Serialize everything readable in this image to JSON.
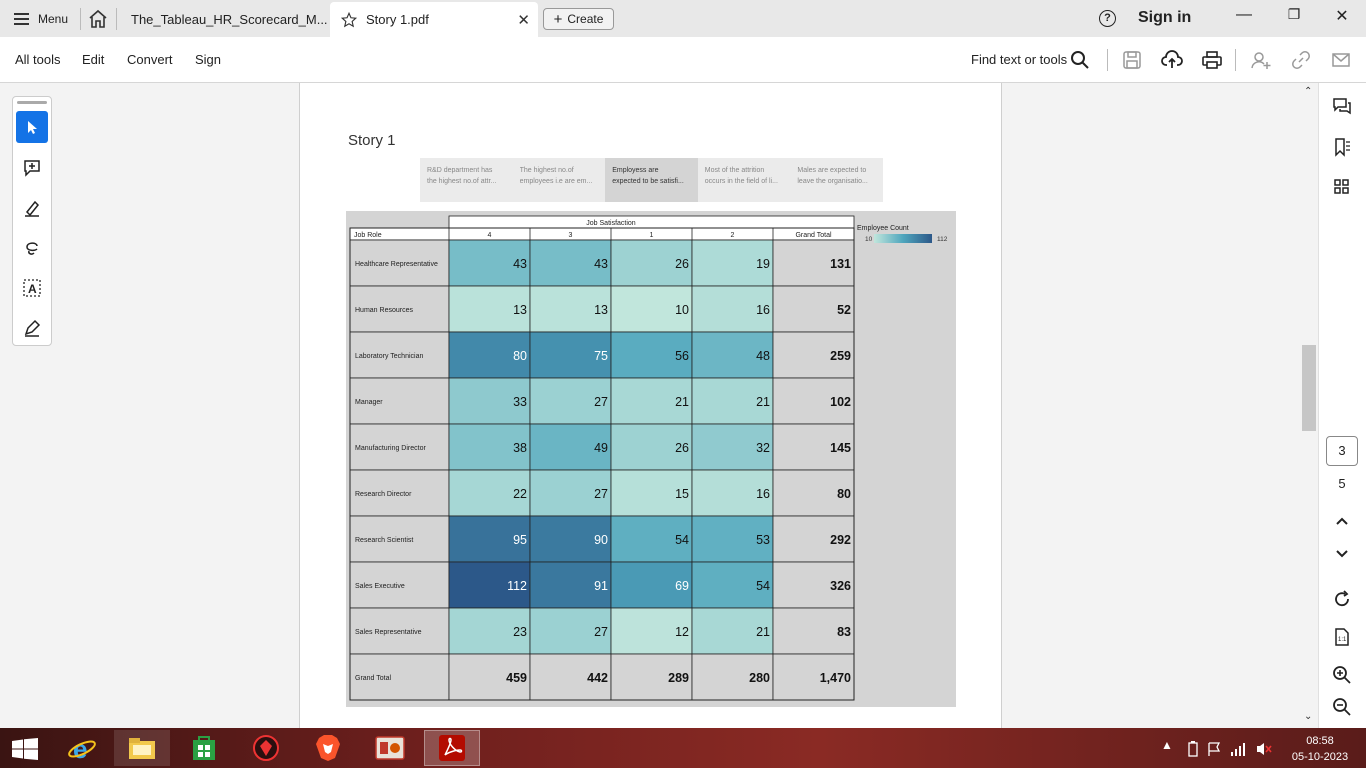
{
  "titlebar": {
    "menu_label": "Menu",
    "tabs": [
      {
        "label": "The_Tableau_HR_Scorecard_M..."
      },
      {
        "label": "Story 1.pdf"
      }
    ],
    "create_label": "Create",
    "help_label": "?",
    "signin_label": "Sign in"
  },
  "toolbar": {
    "items": [
      "All tools",
      "Edit",
      "Convert",
      "Sign"
    ],
    "find_label": "Find text or tools"
  },
  "pager": {
    "current": "3",
    "total": "5"
  },
  "story": {
    "title": "Story 1",
    "points": [
      [
        "R&D department has",
        "the highest no.of attr..."
      ],
      [
        "The highest no.of",
        "employees i.e are em..."
      ],
      [
        "Employess are",
        "expected to be satisfi..."
      ],
      [
        "Most of the attrition",
        "occurs in the field of li..."
      ],
      [
        "Males  are expected to",
        "leave the organisatio..."
      ]
    ],
    "selected_point": 2
  },
  "chart_data": {
    "type": "heatmap",
    "header_title": "Job Satisfaction",
    "row_header": "Job Role",
    "columns": [
      "4",
      "3",
      "1",
      "2"
    ],
    "total_column": "Grand Total",
    "rows": [
      {
        "role": "Healthcare Representative",
        "values": [
          43,
          43,
          26,
          19
        ],
        "total": "131"
      },
      {
        "role": "Human Resources",
        "values": [
          13,
          13,
          10,
          16
        ],
        "total": "52"
      },
      {
        "role": "Laboratory Technician",
        "values": [
          80,
          75,
          56,
          48
        ],
        "total": "259"
      },
      {
        "role": "Manager",
        "values": [
          33,
          27,
          21,
          21
        ],
        "total": "102"
      },
      {
        "role": "Manufacturing Director",
        "values": [
          38,
          49,
          26,
          32
        ],
        "total": "145"
      },
      {
        "role": "Research Director",
        "values": [
          22,
          27,
          15,
          16
        ],
        "total": "80"
      },
      {
        "role": "Research Scientist",
        "values": [
          95,
          90,
          54,
          53
        ],
        "total": "292"
      },
      {
        "role": "Sales Executive",
        "values": [
          112,
          91,
          69,
          54
        ],
        "total": "326"
      },
      {
        "role": "Sales Representative",
        "values": [
          23,
          27,
          12,
          21
        ],
        "total": "83"
      }
    ],
    "grand_total": {
      "label": "Grand Total",
      "values": [
        "459",
        "442",
        "289",
        "280"
      ],
      "total": "1,470"
    },
    "legend": {
      "title": "Employee Count",
      "min": 10,
      "max": 112,
      "min_label": "10",
      "max_label": "112"
    },
    "color_low": "#c1e6dc",
    "color_mid": "#4fa6bd",
    "color_high": "#2c5889"
  },
  "taskbar": {
    "time": "08:58",
    "date": "05-10-2023"
  }
}
